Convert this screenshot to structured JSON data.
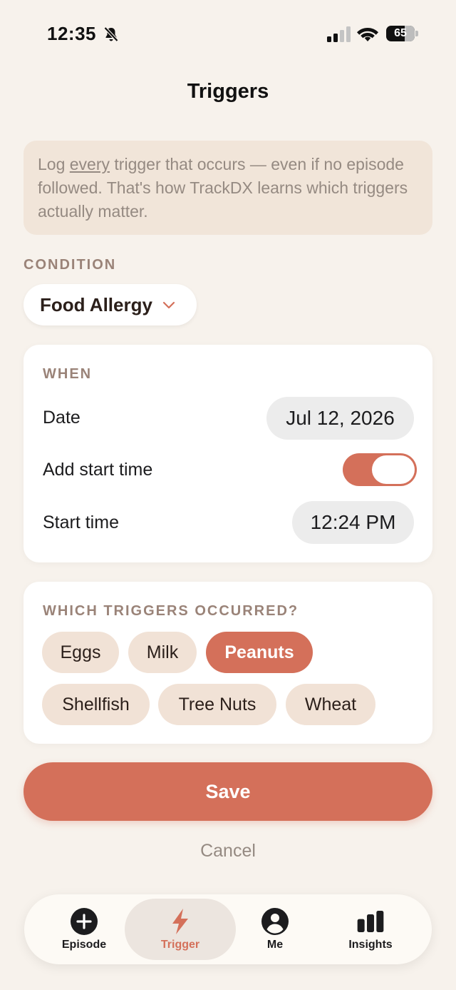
{
  "status_bar": {
    "time": "12:35",
    "battery": "65"
  },
  "header": {
    "title": "Triggers"
  },
  "info": {
    "text_before": "Log ",
    "text_emphasis": "every",
    "text_after": " trigger that occurs — even if no episode followed. That's how TrackDX learns which triggers actually matter."
  },
  "condition": {
    "label": "CONDITION",
    "selected": "Food Allergy"
  },
  "when": {
    "label": "WHEN",
    "date_label": "Date",
    "date_value": "Jul 12, 2026",
    "add_start_time_label": "Add start time",
    "add_start_time_on": true,
    "start_time_label": "Start time",
    "start_time_value": "12:24 PM"
  },
  "triggers": {
    "label": "WHICH TRIGGERS OCCURRED?",
    "options": [
      {
        "label": "Eggs",
        "selected": false
      },
      {
        "label": "Milk",
        "selected": false
      },
      {
        "label": "Peanuts",
        "selected": true
      },
      {
        "label": "Shellfish",
        "selected": false
      },
      {
        "label": "Tree Nuts",
        "selected": false
      },
      {
        "label": "Wheat",
        "selected": false
      }
    ]
  },
  "actions": {
    "save": "Save",
    "cancel": "Cancel"
  },
  "tab_bar": {
    "tabs": [
      {
        "label": "Episode",
        "icon": "plus-circle-icon",
        "active": false
      },
      {
        "label": "Trigger",
        "icon": "lightning-icon",
        "active": true
      },
      {
        "label": "Me",
        "icon": "person-icon",
        "active": false
      },
      {
        "label": "Insights",
        "icon": "bar-chart-icon",
        "active": false
      }
    ]
  },
  "colors": {
    "accent": "#d4705a",
    "background": "#f7f2ec",
    "chip": "#f1e2d6",
    "info_background": "#f1e5d9"
  }
}
